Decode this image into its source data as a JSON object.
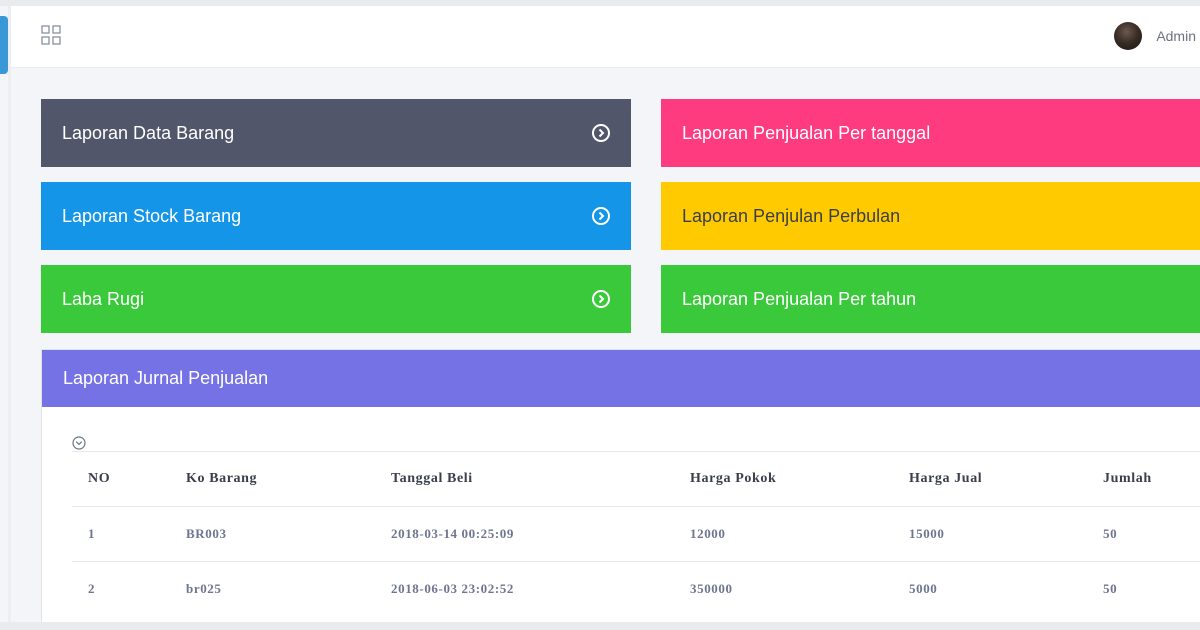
{
  "header": {
    "user_name": "Admin"
  },
  "tiles": [
    {
      "label": "Laporan Data Barang"
    },
    {
      "label": "Laporan Stock Barang"
    },
    {
      "label": "Laba Rugi"
    },
    {
      "label": "Laporan Penjualan Per tanggal"
    },
    {
      "label": "Laporan Penjulan Perbulan"
    },
    {
      "label": "Laporan Penjualan Per tahun"
    }
  ],
  "panel": {
    "title": "Laporan Jurnal Penjualan"
  },
  "table": {
    "columns": [
      "NO",
      "Ko Barang",
      "Tanggal Beli",
      "Harga Pokok",
      "Harga Jual",
      "Jumlah"
    ],
    "rows": [
      [
        "1",
        "BR003",
        "2018-03-14  00:25:09",
        "12000",
        "15000",
        "50"
      ],
      [
        "2",
        "br025",
        "2018-06-03  23:02:52",
        "350000",
        "5000",
        "50"
      ]
    ]
  },
  "colors": {
    "tile_dark": "#52566a",
    "tile_blue": "#1495e8",
    "tile_green": "#39c93b",
    "tile_pink": "#fe3b7e",
    "tile_yellow": "#ffcb00",
    "panel_header": "#7572e5"
  },
  "icons": {
    "topbar": "grid-icon",
    "tile_arrow": "chevron-right-circle-icon",
    "panel_toggle": "chevron-down-circle-icon"
  }
}
